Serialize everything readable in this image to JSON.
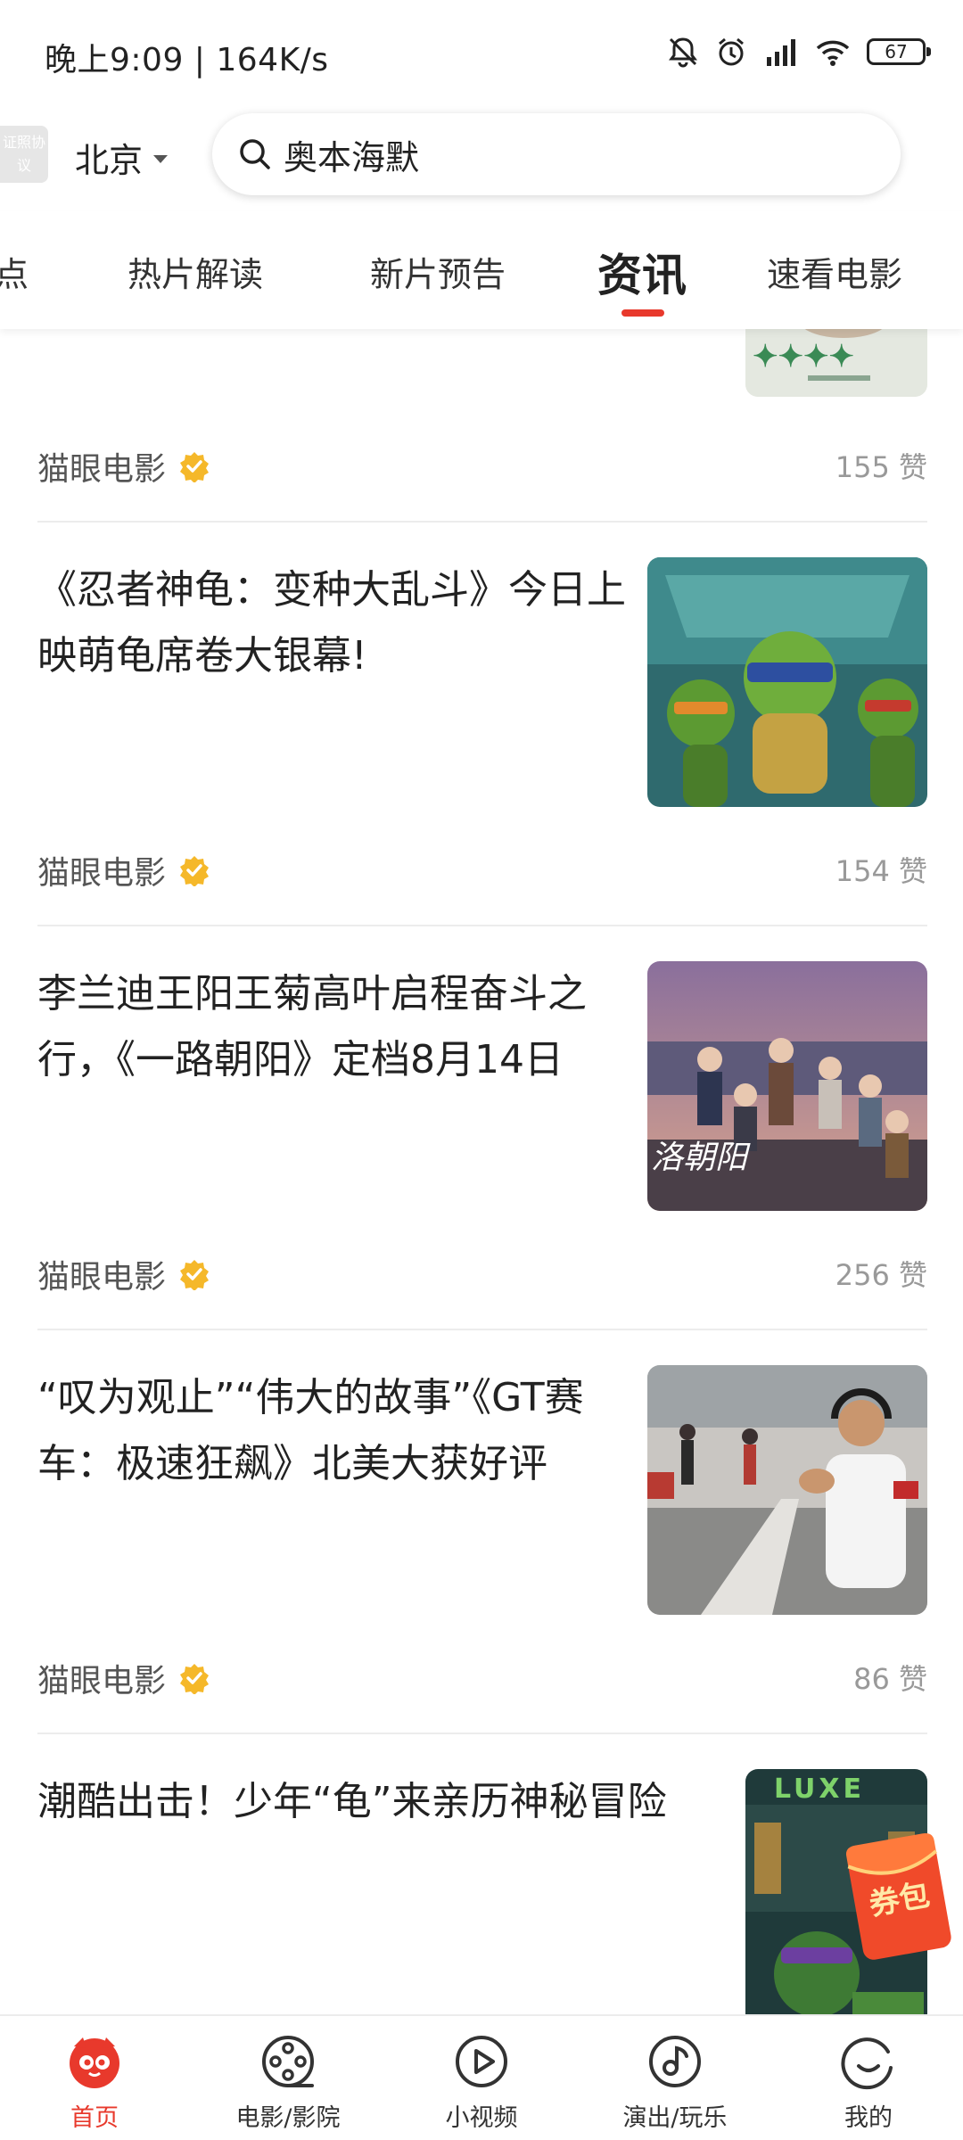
{
  "status_bar": {
    "time_speed": "晚上9:09 | 164K/s",
    "battery": "67"
  },
  "header": {
    "license_badge": "证照协议",
    "city": "北京",
    "search_text": "奥本海默"
  },
  "tabs": [
    {
      "label": "点"
    },
    {
      "label": "热片解读"
    },
    {
      "label": "新片预告"
    },
    {
      "label": "资讯"
    },
    {
      "label": "速看电影"
    }
  ],
  "feed": {
    "top_item": {
      "source": "猫眼电影",
      "likes": "155 赞"
    },
    "articles": [
      {
        "title": "《忍者神龟：变种大乱斗》今日上映萌龟席卷大银幕!",
        "source": "猫眼电影",
        "likes": "154 赞"
      },
      {
        "title": "李兰迪王阳王菊高叶启程奋斗之行，《一路朝阳》定档8月14日",
        "source": "猫眼电影",
        "likes": "256 赞"
      },
      {
        "title": "“叹为观止”“伟大的故事”《GT赛车：极速狂飙》北美大获好评",
        "source": "猫眼电影",
        "likes": "86 赞"
      },
      {
        "title": "潮酷出击！少年“龟”来亲历神秘冒险"
      }
    ]
  },
  "coupon": {
    "label": "券包"
  },
  "bottom_nav": [
    {
      "label": "首页",
      "icon": "cat-home-icon",
      "active": true
    },
    {
      "label": "电影/影院",
      "icon": "film-reel-icon"
    },
    {
      "label": "小视频",
      "icon": "play-icon"
    },
    {
      "label": "演出/玩乐",
      "icon": "music-note-icon"
    },
    {
      "label": "我的",
      "icon": "profile-icon"
    }
  ],
  "colors": {
    "accent": "#e8392c",
    "verified": "#f5b82a"
  }
}
